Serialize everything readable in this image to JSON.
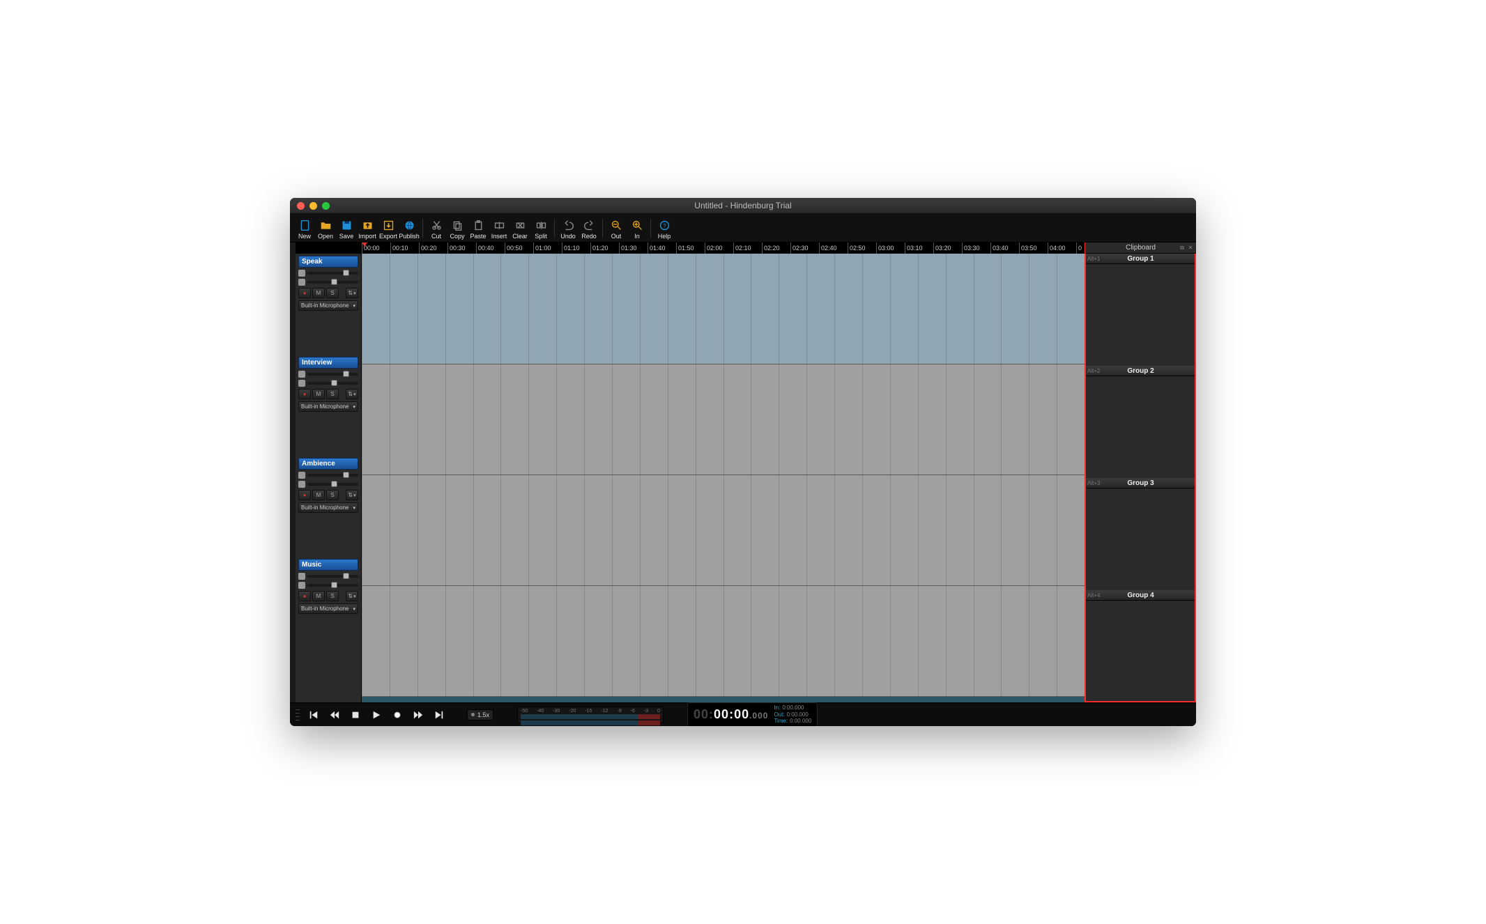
{
  "window": {
    "title": "Untitled - Hindenburg Trial"
  },
  "toolbar": {
    "file": [
      {
        "id": "new",
        "label": "New"
      },
      {
        "id": "open",
        "label": "Open"
      },
      {
        "id": "save",
        "label": "Save"
      },
      {
        "id": "import",
        "label": "Import"
      },
      {
        "id": "export",
        "label": "Export"
      },
      {
        "id": "publish",
        "label": "Publish"
      }
    ],
    "edit": [
      {
        "id": "cut",
        "label": "Cut"
      },
      {
        "id": "copy",
        "label": "Copy"
      },
      {
        "id": "paste",
        "label": "Paste"
      },
      {
        "id": "insert",
        "label": "Insert"
      },
      {
        "id": "clear",
        "label": "Clear"
      },
      {
        "id": "split",
        "label": "Split"
      }
    ],
    "history": [
      {
        "id": "undo",
        "label": "Undo"
      },
      {
        "id": "redo",
        "label": "Redo"
      }
    ],
    "zoom": [
      {
        "id": "zoomout",
        "label": "Out"
      },
      {
        "id": "zoomin",
        "label": "In"
      }
    ],
    "help": [
      {
        "id": "help",
        "label": "Help"
      }
    ]
  },
  "ruler": [
    "00:00",
    "00:10",
    "00:20",
    "00:30",
    "00:40",
    "00:50",
    "01:00",
    "01:10",
    "01:20",
    "01:30",
    "01:40",
    "01:50",
    "02:00",
    "02:10",
    "02:20",
    "02:30",
    "02:40",
    "02:50",
    "03:00",
    "03:10",
    "03:20",
    "03:30",
    "03:40",
    "03:50",
    "04:00",
    "0"
  ],
  "tracks": [
    {
      "name": "Speak",
      "input": "Built-in Microphone",
      "highlight": true
    },
    {
      "name": "Interview",
      "input": "Built-in Microphone",
      "highlight": false
    },
    {
      "name": "Ambience",
      "input": "Built-in Microphone",
      "highlight": false
    },
    {
      "name": "Music",
      "input": "Built-in Microphone",
      "highlight": false
    }
  ],
  "track_buttons": {
    "rec": "●",
    "mute": "M",
    "solo": "S",
    "fx": "⇅"
  },
  "clipboard": {
    "title": "Clipboard",
    "groups": [
      {
        "shortcut": "Alt+1",
        "name": "Group 1"
      },
      {
        "shortcut": "Alt+2",
        "name": "Group 2"
      },
      {
        "shortcut": "Alt+3",
        "name": "Group 3"
      },
      {
        "shortcut": "Alt+4",
        "name": "Group 4"
      }
    ]
  },
  "transport": {
    "speed": "1.5x",
    "meter_scale": [
      "-50",
      "-40",
      "-30",
      "-20",
      "-15",
      "-12",
      "-9",
      "-6",
      "-3",
      "0"
    ],
    "counter_hours": "00",
    "counter_main": "00:00",
    "counter_ms": ".000",
    "info": [
      {
        "k": "In:",
        "v": "0:00.000"
      },
      {
        "k": "Out:",
        "v": "0:00.000"
      },
      {
        "k": "Time:",
        "v": "0:00.000"
      }
    ]
  }
}
